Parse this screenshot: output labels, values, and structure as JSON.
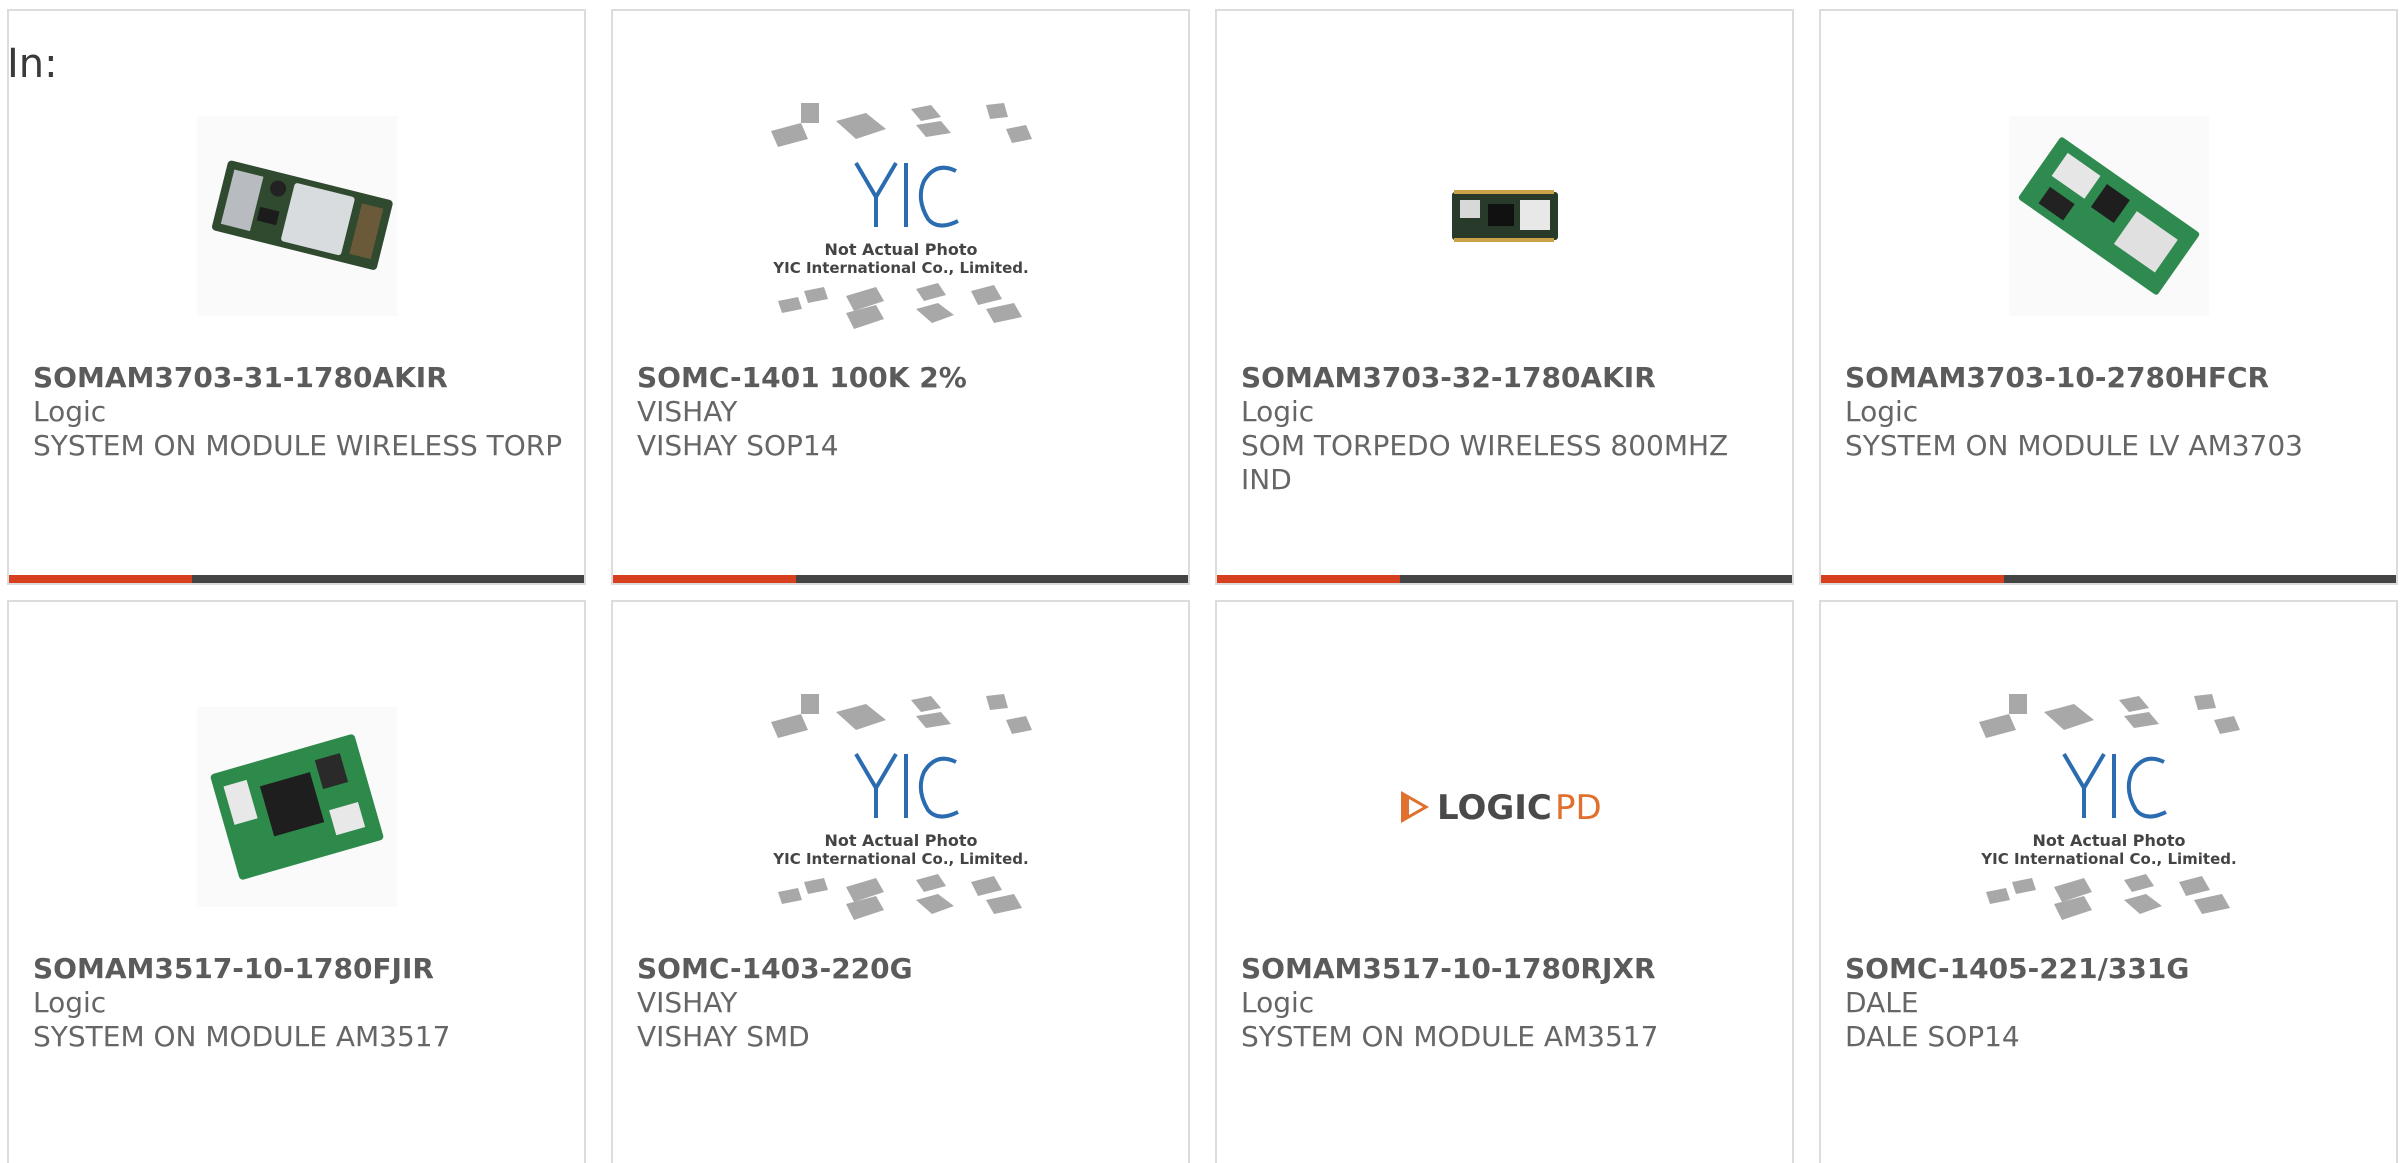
{
  "header": {
    "in_label": "In:"
  },
  "accent_color": "#d6401e",
  "bar_color": "#444444",
  "products": [
    {
      "part_number": "SOMAM3703-31-1780AKIR",
      "brand": "Logic",
      "description": "SYSTEM ON MODULE WIRELESS TORP",
      "image": "module-wireless-photo"
    },
    {
      "part_number": "SOMC-1401 100K 2%",
      "brand": "VISHAY",
      "description": "VISHAY SOP14",
      "image": "yic-placeholder",
      "placeholder_line1": "Not Actual Photo",
      "placeholder_line2": "YIC International Co., Limited."
    },
    {
      "part_number": "SOMAM3703-32-1780AKIR",
      "brand": "Logic",
      "description": "SOM TORPEDO WIRELESS 800MHZ IND",
      "image": "module-small-photo"
    },
    {
      "part_number": "SOMAM3703-10-2780HFCR",
      "brand": "Logic",
      "description": "SYSTEM ON MODULE LV AM3703",
      "image": "module-green-board-photo"
    },
    {
      "part_number": "SOMAM3517-10-1780FJIR",
      "brand": "Logic",
      "description": "SYSTEM ON MODULE AM3517",
      "image": "module-am3517-photo"
    },
    {
      "part_number": "SOMC-1403-220G",
      "brand": "VISHAY",
      "description": "VISHAY SMD",
      "image": "yic-placeholder",
      "placeholder_line1": "Not Actual Photo",
      "placeholder_line2": "YIC International Co., Limited."
    },
    {
      "part_number": "SOMAM3517-10-1780RJXR",
      "brand": "Logic",
      "description": "SYSTEM ON MODULE AM3517",
      "image": "logicpd-logo",
      "logo_text_1": "LOGIC",
      "logo_text_2": "PD"
    },
    {
      "part_number": "SOMC-1405-221/331G",
      "brand": "DALE",
      "description": "DALE SOP14",
      "image": "yic-placeholder",
      "placeholder_line1": "Not Actual Photo",
      "placeholder_line2": "YIC International Co., Limited."
    }
  ]
}
